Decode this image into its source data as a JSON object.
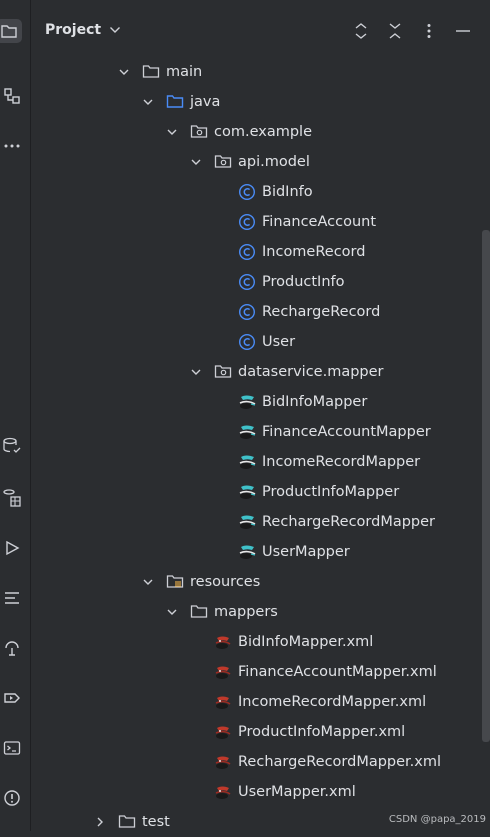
{
  "header": {
    "title": "Project"
  },
  "tree": [
    {
      "label": "main",
      "depth": 0,
      "expanded": true,
      "icon": "folder-icon",
      "kind": "folder"
    },
    {
      "label": "java",
      "depth": 1,
      "expanded": true,
      "icon": "source-folder-icon",
      "kind": "source"
    },
    {
      "label": "com.example",
      "depth": 2,
      "expanded": true,
      "icon": "package-icon",
      "kind": "package"
    },
    {
      "label": "api.model",
      "depth": 3,
      "expanded": true,
      "icon": "package-icon",
      "kind": "package"
    },
    {
      "label": "BidInfo",
      "depth": 4,
      "icon": "class-icon",
      "kind": "class"
    },
    {
      "label": "FinanceAccount",
      "depth": 4,
      "icon": "class-icon",
      "kind": "class"
    },
    {
      "label": "IncomeRecord",
      "depth": 4,
      "icon": "class-icon",
      "kind": "class"
    },
    {
      "label": "ProductInfo",
      "depth": 4,
      "icon": "class-icon",
      "kind": "class"
    },
    {
      "label": "RechargeRecord",
      "depth": 4,
      "icon": "class-icon",
      "kind": "class"
    },
    {
      "label": "User",
      "depth": 4,
      "icon": "class-icon",
      "kind": "class"
    },
    {
      "label": "dataservice.mapper",
      "depth": 3,
      "expanded": true,
      "icon": "package-icon",
      "kind": "package"
    },
    {
      "label": "BidInfoMapper",
      "depth": 4,
      "icon": "mybatis-mapper-icon",
      "kind": "mapper"
    },
    {
      "label": "FinanceAccountMapper",
      "depth": 4,
      "icon": "mybatis-mapper-icon",
      "kind": "mapper"
    },
    {
      "label": "IncomeRecordMapper",
      "depth": 4,
      "icon": "mybatis-mapper-icon",
      "kind": "mapper"
    },
    {
      "label": "ProductInfoMapper",
      "depth": 4,
      "icon": "mybatis-mapper-icon",
      "kind": "mapper"
    },
    {
      "label": "RechargeRecordMapper",
      "depth": 4,
      "icon": "mybatis-mapper-icon",
      "kind": "mapper"
    },
    {
      "label": "UserMapper",
      "depth": 4,
      "icon": "mybatis-mapper-icon",
      "kind": "mapper"
    },
    {
      "label": "resources",
      "depth": 1,
      "expanded": true,
      "icon": "resources-folder-icon",
      "kind": "resources"
    },
    {
      "label": "mappers",
      "depth": 2,
      "expanded": true,
      "icon": "folder-icon",
      "kind": "folder"
    },
    {
      "label": "BidInfoMapper.xml",
      "depth": 3,
      "icon": "mybatis-xml-icon",
      "kind": "xml"
    },
    {
      "label": "FinanceAccountMapper.xml",
      "depth": 3,
      "icon": "mybatis-xml-icon",
      "kind": "xml"
    },
    {
      "label": "IncomeRecordMapper.xml",
      "depth": 3,
      "icon": "mybatis-xml-icon",
      "kind": "xml"
    },
    {
      "label": "ProductInfoMapper.xml",
      "depth": 3,
      "icon": "mybatis-xml-icon",
      "kind": "xml"
    },
    {
      "label": "RechargeRecordMapper.xml",
      "depth": 3,
      "icon": "mybatis-xml-icon",
      "kind": "xml"
    },
    {
      "label": "UserMapper.xml",
      "depth": 3,
      "icon": "mybatis-xml-icon",
      "kind": "xml"
    },
    {
      "label": "test",
      "depth": -1,
      "expanded": false,
      "icon": "folder-icon",
      "kind": "folder"
    }
  ],
  "watermark": "CSDN @papa_2019",
  "colors": {
    "background": "#2b2d30",
    "text": "#dfe1e5",
    "class_icon": "#4a8cf7",
    "source_folder": "#4a8cf7",
    "mapper_accent": "#3fc1c9",
    "xml_red": "#c0392b"
  }
}
